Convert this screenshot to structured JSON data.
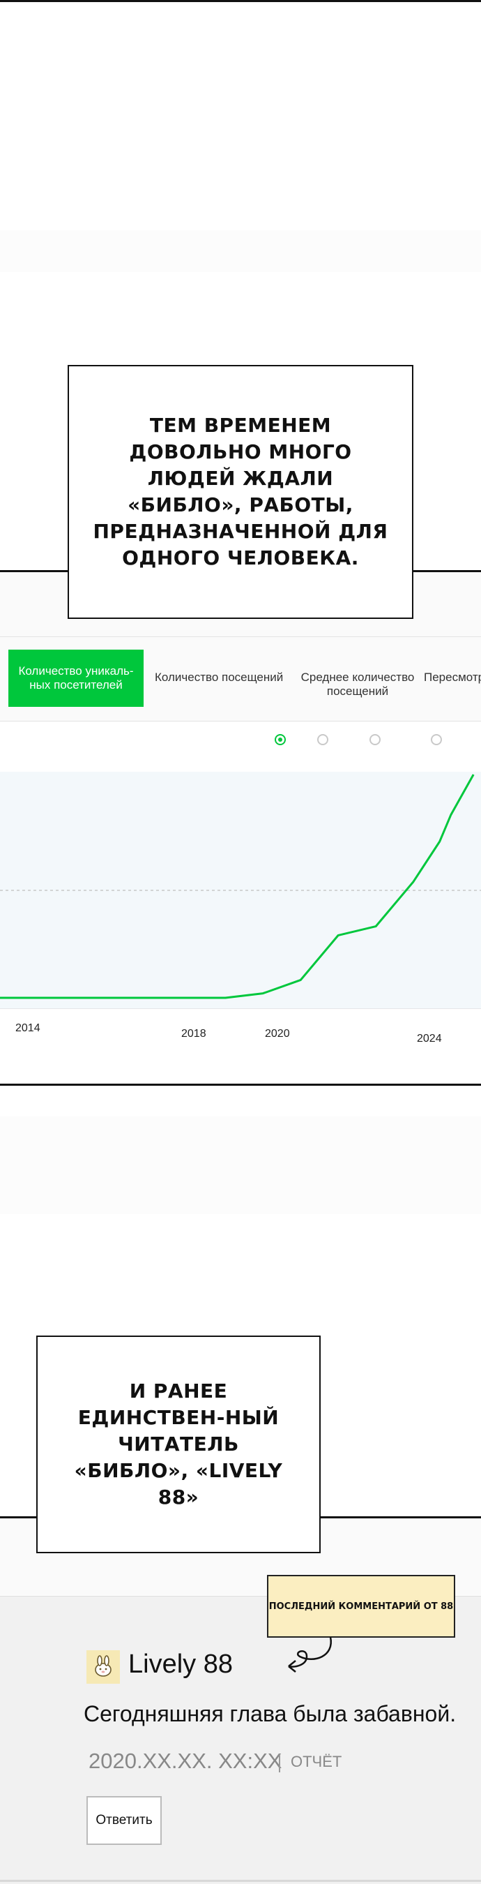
{
  "captions": {
    "top": "ТЕМ ВРЕМЕНЕМ ДОВОЛЬНО МНОГО ЛЮДЕЙ ЖДАЛИ «БИБЛО», РАБОТЫ, ПРЕДНАЗНАЧЕННОЙ ДЛЯ ОДНОГО ЧЕЛОВЕКА.",
    "bottom": "И РАНЕЕ ЕДИНСТВЕН-НЫЙ ЧИТАТЕЛЬ «БИБЛО», «LIVELY 88»"
  },
  "stats_tabs": [
    {
      "label": "Количество уникаль-ных посетителей",
      "active": true
    },
    {
      "label": "Количество посещений",
      "active": false
    },
    {
      "label": "Среднее количество посещений",
      "active": false
    },
    {
      "label": "Пересмотр",
      "active": false
    }
  ],
  "chart_data": {
    "type": "line",
    "x_ticks": [
      "2014",
      "2018",
      "2020",
      "2024"
    ],
    "x": [
      2012,
      2014,
      2016,
      2018,
      2019,
      2020,
      2021,
      2022,
      2023,
      2023.7,
      2024,
      2024.6
    ],
    "y": [
      0,
      0,
      0,
      0,
      2,
      8,
      28,
      32,
      52,
      70,
      82,
      100
    ],
    "ylim": [
      0,
      100
    ],
    "line_color": "#00c73c",
    "grid": true
  },
  "comment": {
    "tag": "ПОСЛЕДНИЙ КОММЕНТАРИЙ ОТ 88",
    "user": "Lively 88",
    "text": "Сегодняшняя глава была забавной.",
    "date": "2020.XX.XX. XX:XX",
    "report": "ОТЧЁТ",
    "reply": "Ответить"
  }
}
